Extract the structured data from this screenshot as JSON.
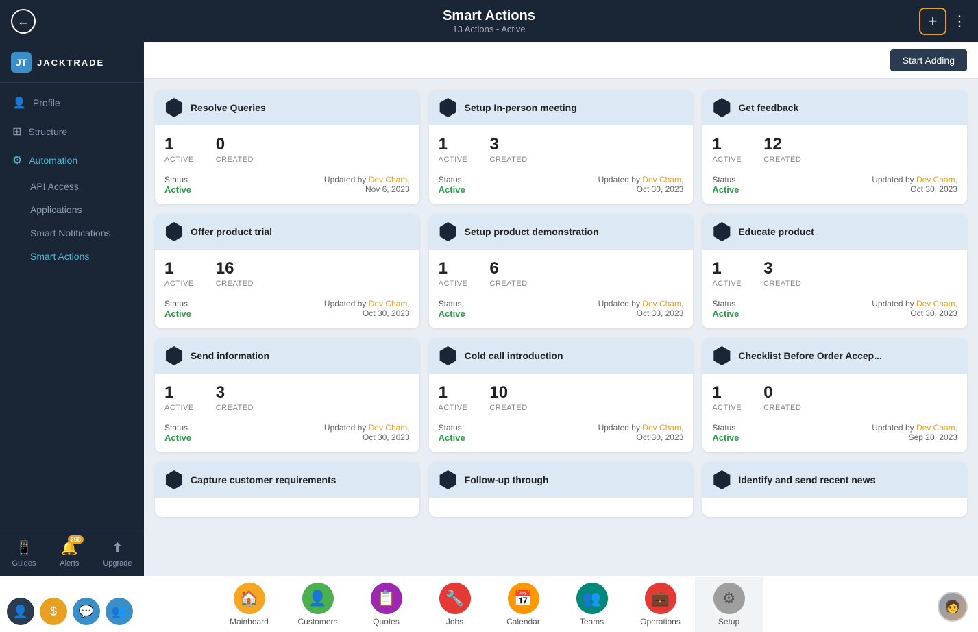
{
  "header": {
    "title": "Smart Actions",
    "subtitle": "13 Actions - Active",
    "back_button": "‹",
    "add_button": "+",
    "dots": "⋮"
  },
  "sidebar": {
    "logo_text": "JACKTRADE",
    "items": [
      {
        "id": "profile",
        "label": "Profile",
        "icon": "👤",
        "active": false
      },
      {
        "id": "structure",
        "label": "Structure",
        "icon": "⊞",
        "active": false
      },
      {
        "id": "automation",
        "label": "Automation",
        "icon": "⚙",
        "active": true
      },
      {
        "id": "api-access",
        "label": "API Access",
        "icon": "",
        "sub": true,
        "active": false
      },
      {
        "id": "applications",
        "label": "Applications",
        "icon": "",
        "sub": true,
        "active": false
      },
      {
        "id": "smart-notifications",
        "label": "Smart Notifications",
        "icon": "",
        "sub": true,
        "active": false
      },
      {
        "id": "smart-actions",
        "label": "Smart Actions",
        "icon": "",
        "sub": true,
        "active": true
      }
    ],
    "bottom": [
      {
        "id": "guides",
        "label": "Guides",
        "icon": "📱"
      },
      {
        "id": "alerts",
        "label": "Alerts",
        "icon": "🔔",
        "badge": "268"
      },
      {
        "id": "upgrade",
        "label": "Upgrade",
        "icon": "⬆"
      }
    ]
  },
  "toolbar": {
    "start_adding_label": "Start Adding"
  },
  "cards": [
    {
      "id": "resolve-queries",
      "title": "Resolve Queries",
      "active_count": "1",
      "created_count": "0",
      "status": "Active",
      "updated_by": "Dev Cham,",
      "updated_date": "Nov 6, 2023"
    },
    {
      "id": "setup-inperson",
      "title": "Setup In-person meeting",
      "active_count": "1",
      "created_count": "3",
      "status": "Active",
      "updated_by": "Dev Cham,",
      "updated_date": "Oct 30, 2023"
    },
    {
      "id": "get-feedback",
      "title": "Get feedback",
      "active_count": "1",
      "created_count": "12",
      "status": "Active",
      "updated_by": "Dev Cham,",
      "updated_date": "Oct 30, 2023"
    },
    {
      "id": "offer-product-trial",
      "title": "Offer product trial",
      "active_count": "1",
      "created_count": "16",
      "status": "Active",
      "updated_by": "Dev Cham,",
      "updated_date": "Oct 30, 2023"
    },
    {
      "id": "setup-product-demo",
      "title": "Setup product demonstration",
      "active_count": "1",
      "created_count": "6",
      "status": "Active",
      "updated_by": "Dev Cham,",
      "updated_date": "Oct 30, 2023"
    },
    {
      "id": "educate-product",
      "title": "Educate product",
      "active_count": "1",
      "created_count": "3",
      "status": "Active",
      "updated_by": "Dev Cham,",
      "updated_date": "Oct 30, 2023"
    },
    {
      "id": "send-information",
      "title": "Send information",
      "active_count": "1",
      "created_count": "3",
      "status": "Active",
      "updated_by": "Dev Cham,",
      "updated_date": "Oct 30, 2023"
    },
    {
      "id": "cold-call-introduction",
      "title": "Cold call introduction",
      "active_count": "1",
      "created_count": "10",
      "status": "Active",
      "updated_by": "Dev Cham,",
      "updated_date": "Oct 30, 2023"
    },
    {
      "id": "checklist-before-order",
      "title": "Checklist Before Order Accep...",
      "active_count": "1",
      "created_count": "0",
      "status": "Active",
      "updated_by": "Dev Cham,",
      "updated_date": "Sep 20, 2023"
    },
    {
      "id": "capture-customer",
      "title": "Capture customer requirements",
      "active_count": "",
      "created_count": "",
      "status": "",
      "updated_by": "",
      "updated_date": ""
    },
    {
      "id": "follow-up-through",
      "title": "Follow-up through",
      "active_count": "",
      "created_count": "",
      "status": "",
      "updated_by": "",
      "updated_date": ""
    },
    {
      "id": "identify-send-news",
      "title": "Identify and send recent news",
      "active_count": "",
      "created_count": "",
      "status": "",
      "updated_by": "",
      "updated_date": ""
    }
  ],
  "labels": {
    "active": "ACTIVE",
    "created": "CREATED",
    "status": "Status",
    "updated_by_prefix": "Updated by"
  },
  "bottom_nav": [
    {
      "id": "mainboard",
      "label": "Mainboard",
      "icon": "🏠",
      "color_class": "nav-icon-mainboard"
    },
    {
      "id": "customers",
      "label": "Customers",
      "icon": "👤",
      "color_class": "nav-icon-customers"
    },
    {
      "id": "quotes",
      "label": "Quotes",
      "icon": "📋",
      "color_class": "nav-icon-quotes"
    },
    {
      "id": "jobs",
      "label": "Jobs",
      "icon": "🔧",
      "color_class": "nav-icon-jobs"
    },
    {
      "id": "calendar",
      "label": "Calendar",
      "icon": "📅",
      "color_class": "nav-icon-calendar"
    },
    {
      "id": "teams",
      "label": "Teams",
      "icon": "👥",
      "color_class": "nav-icon-teams"
    },
    {
      "id": "operations",
      "label": "Operations",
      "icon": "💼",
      "color_class": "nav-icon-operations"
    },
    {
      "id": "setup",
      "label": "Setup",
      "icon": "⚙",
      "color_class": "nav-icon-setup",
      "active": true
    }
  ]
}
